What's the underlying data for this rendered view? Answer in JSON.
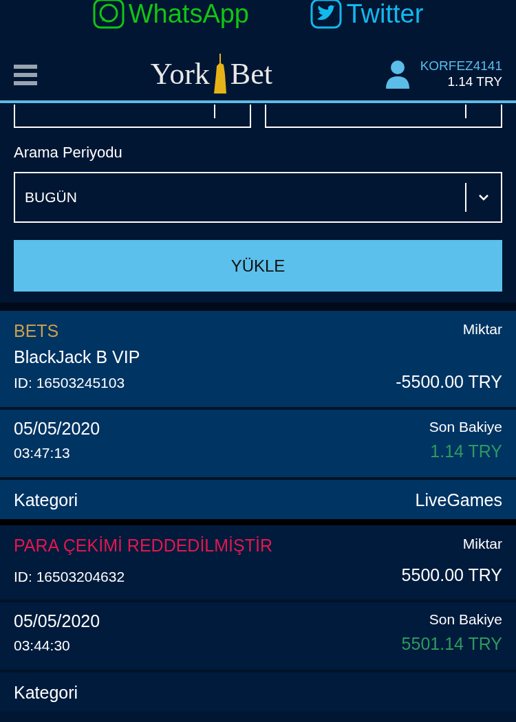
{
  "social": [
    {
      "kind": "whatsapp",
      "label": "WhatsApp"
    },
    {
      "kind": "twitter",
      "label": "Twitter"
    }
  ],
  "header": {
    "logo_left": "York",
    "logo_right": "Bet",
    "username": "KORFEZ4141",
    "balance": "1.14 TRY"
  },
  "filters": {
    "period_label": "Arama Periyodu",
    "period_value": "BUGÜN",
    "load_button": "YÜKLE"
  },
  "transactions": [
    {
      "kind": "bet",
      "status": "BETS",
      "color": "#c9a04a",
      "game": "BlackJack B VIP",
      "amount_label": "Miktar",
      "id": "ID: 16503245103",
      "amount": "-5500.00 TRY",
      "date": "05/05/2020",
      "time": "03:47:13",
      "balance_label": "Son Bakiye",
      "balance": "1.14 TRY",
      "category_label": "Kategori",
      "category": "LiveGames"
    },
    {
      "kind": "withdrawal",
      "status": "PARA ÇEKİMİ REDDEDİLMİŞTİR",
      "color": "#e3174f",
      "amount_label": "Miktar",
      "id": "ID: 16503204632",
      "amount": "5500.00 TRY",
      "date": "05/05/2020",
      "time": "03:44:30",
      "balance_label": "Son Bakiye",
      "balance": "5501.14 TRY",
      "category_label": "Kategori"
    }
  ]
}
